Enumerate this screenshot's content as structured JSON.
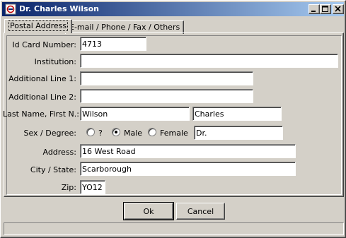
{
  "window": {
    "title": "Dr. Charles Wilson"
  },
  "tabs": [
    {
      "label": "Postal Address",
      "active": true
    },
    {
      "label": "E-mail / Phone / Fax / Others",
      "active": false
    }
  ],
  "form": {
    "id_card": {
      "label": "Id Card Number:",
      "value": "4713"
    },
    "institution": {
      "label": "Institution:",
      "value": ""
    },
    "additional_line_1": {
      "label": "Additional Line 1:",
      "value": ""
    },
    "additional_line_2": {
      "label": "Additional Line 2:",
      "value": ""
    },
    "name": {
      "label": "Last Name, First N.:",
      "last": "Wilson",
      "first": "Charles"
    },
    "sex_degree": {
      "label": "Sex / Degree:",
      "options": [
        {
          "label": "?",
          "selected": false
        },
        {
          "label": "Male",
          "selected": true
        },
        {
          "label": "Female",
          "selected": false
        }
      ],
      "degree": "Dr."
    },
    "address": {
      "label": "Address:",
      "value": "16 West Road"
    },
    "city_state": {
      "label": "City / State:",
      "value": "Scarborough"
    },
    "zip": {
      "label": "Zip:",
      "value": "YO12"
    }
  },
  "buttons": {
    "ok": "Ok",
    "cancel": "Cancel"
  },
  "colors": {
    "face": "#d4d0c8",
    "titlebar_start": "#0a246a",
    "titlebar_end": "#a6caf0"
  }
}
